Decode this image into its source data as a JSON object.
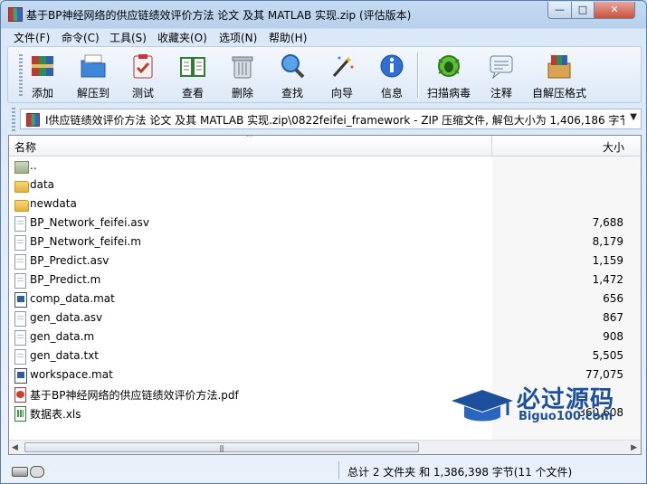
{
  "window": {
    "title": "基于BP神经网络的供应链绩效评价方法 论文 及其 MATLAB 实现.zip (评估版本)",
    "minimize_label": "—",
    "maximize_label": "□",
    "close_label": "✕"
  },
  "menu": [
    "文件(F)",
    "命令(C)",
    "工具(S)",
    "收藏夹(O)",
    "选项(N)",
    "帮助(H)"
  ],
  "toolbar": [
    {
      "label": "添加",
      "icon": "add-archive-icon"
    },
    {
      "label": "解压到",
      "icon": "extract-folder-icon"
    },
    {
      "label": "测试",
      "icon": "test-clipboard-icon"
    },
    {
      "label": "查看",
      "icon": "view-book-icon"
    },
    {
      "label": "删除",
      "icon": "trash-icon"
    },
    {
      "label": "查找",
      "icon": "magnifier-icon"
    },
    {
      "label": "向导",
      "icon": "wand-icon"
    },
    {
      "label": "信息",
      "icon": "info-icon"
    },
    {
      "label": "扫描病毒",
      "icon": "virus-scan-icon"
    },
    {
      "label": "注释",
      "icon": "comment-icon"
    },
    {
      "label": "自解压格式",
      "icon": "sfx-box-icon"
    }
  ],
  "address": {
    "path": "I供应链绩效评价方法 论文 及其 MATLAB 实现.zip\\0822feifei_framework - ZIP 压缩文件, 解包大小为 1,406,186 字节"
  },
  "columns": {
    "name": "名称",
    "size": "大小",
    "sort_indicator": "^"
  },
  "files": [
    {
      "name": "..",
      "size": "",
      "type": "up"
    },
    {
      "name": "data",
      "size": "",
      "type": "folder"
    },
    {
      "name": "newdata",
      "size": "",
      "type": "folder"
    },
    {
      "name": "BP_Network_feifei.asv",
      "size": "7,688",
      "type": "doc"
    },
    {
      "name": "BP_Network_feifei.m",
      "size": "8,179",
      "type": "doc"
    },
    {
      "name": "BP_Predict.asv",
      "size": "1,159",
      "type": "doc"
    },
    {
      "name": "BP_Predict.m",
      "size": "1,472",
      "type": "doc"
    },
    {
      "name": "comp_data.mat",
      "size": "656",
      "type": "mat"
    },
    {
      "name": "gen_data.asv",
      "size": "867",
      "type": "doc"
    },
    {
      "name": "gen_data.m",
      "size": "908",
      "type": "doc"
    },
    {
      "name": "gen_data.txt",
      "size": "5,505",
      "type": "doc"
    },
    {
      "name": "workspace.mat",
      "size": "77,075",
      "type": "mat"
    },
    {
      "name": "基于BP神经网络的供应链绩效评价方法.pdf",
      "size": "",
      "type": "pdf"
    },
    {
      "name": "数据表.xls",
      "size": "360,608",
      "type": "xls"
    }
  ],
  "status": {
    "summary": "总计 2 文件夹 和 1,386,398 字节(11 个文件)"
  },
  "watermark": {
    "cn": "必过源码",
    "en": "Biguo100.com"
  },
  "colors": {
    "titlebar": "#c5dbf3",
    "accent": "#1d4f9c",
    "close": "#c9523f"
  }
}
